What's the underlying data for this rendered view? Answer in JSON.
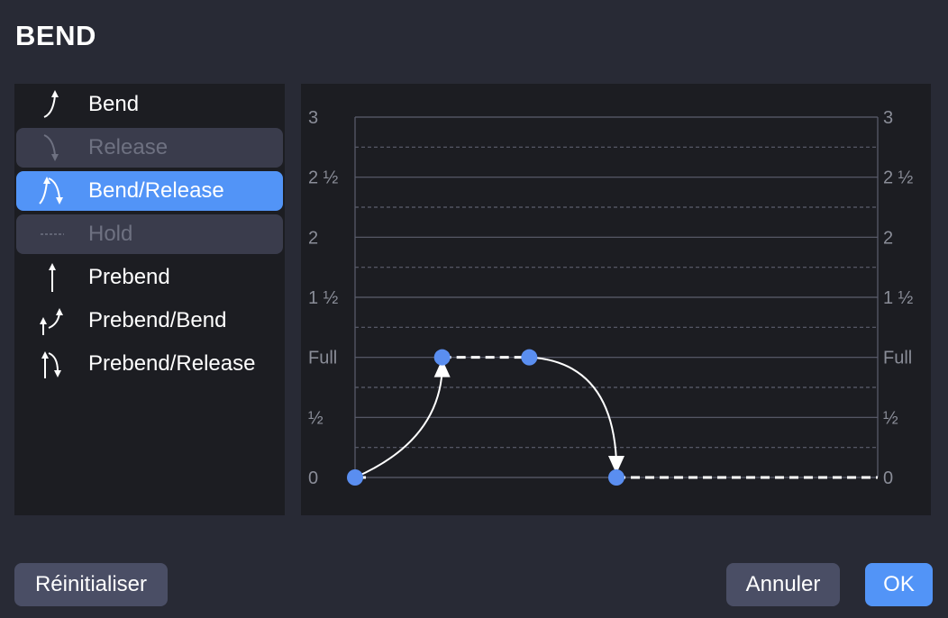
{
  "dialog": {
    "title": "BEND"
  },
  "types": [
    {
      "label": "Bend",
      "icon": "bend-icon",
      "state": "normal"
    },
    {
      "label": "Release",
      "icon": "release-icon",
      "state": "disabled"
    },
    {
      "label": "Bend/Release",
      "icon": "bend-release-icon",
      "state": "selected"
    },
    {
      "label": "Hold",
      "icon": "hold-icon",
      "state": "disabled"
    },
    {
      "label": "Prebend",
      "icon": "prebend-icon",
      "state": "normal"
    },
    {
      "label": "Prebend/Bend",
      "icon": "prebend-bend-icon",
      "state": "normal"
    },
    {
      "label": "Prebend/Release",
      "icon": "prebend-release-icon",
      "state": "normal"
    }
  ],
  "graph": {
    "y_labels": [
      "3",
      "2 ½",
      "2",
      "1 ½",
      "Full",
      "½",
      "0"
    ],
    "points": [
      {
        "x": 0,
        "y": 0
      },
      {
        "x": 2,
        "y": 1
      },
      {
        "x": 4,
        "y": 1
      },
      {
        "x": 6,
        "y": 0
      }
    ],
    "x_max": 12,
    "y_max": 3,
    "colors": {
      "point": "#5a8ef0",
      "line": "#ffffff",
      "grid": "#5c5f6e"
    }
  },
  "buttons": {
    "reset": "Réinitialiser",
    "cancel": "Annuler",
    "ok": "OK"
  }
}
